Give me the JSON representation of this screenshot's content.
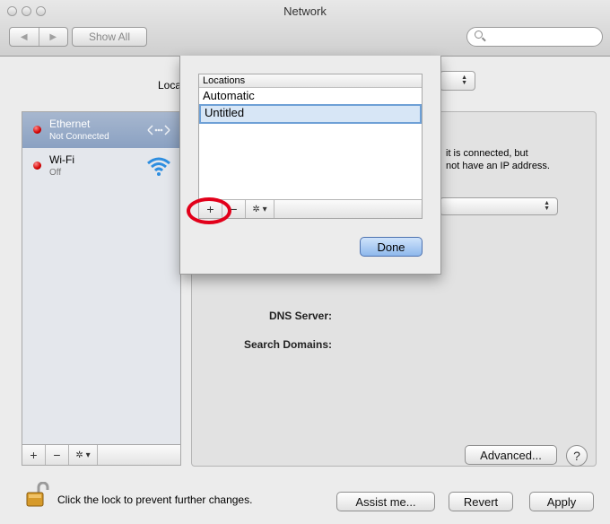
{
  "window": {
    "title": "Network"
  },
  "toolbar": {
    "back": "◀",
    "forward": "▶",
    "show_all": "Show All"
  },
  "location": {
    "label": "Location:"
  },
  "services": [
    {
      "name": "Ethernet",
      "status": "Not Connected",
      "selected": true
    },
    {
      "name": "Wi-Fi",
      "status": "Off",
      "selected": false
    }
  ],
  "service_bar": {
    "add": "+",
    "remove": "−",
    "gear": "✲ ▾"
  },
  "detail": {
    "status_line1": "it is connected, but",
    "status_line2": "not have an IP address.",
    "dns_label": "DNS Server:",
    "search_label": "Search Domains:",
    "advanced": "Advanced...",
    "help": "?"
  },
  "footer": {
    "lock_text": "Click the lock to prevent further changes.",
    "assist": "Assist me...",
    "revert": "Revert",
    "apply": "Apply"
  },
  "locations_sheet": {
    "header": "Locations",
    "items": [
      "Automatic",
      "Untitled"
    ],
    "selected_index": 1,
    "add": "+",
    "remove": "−",
    "gear": "✲ ▾",
    "done": "Done"
  },
  "colors": {
    "accent_circle": "#e2001a",
    "selection": "#8aa1c2",
    "status_red": "#d10000"
  }
}
